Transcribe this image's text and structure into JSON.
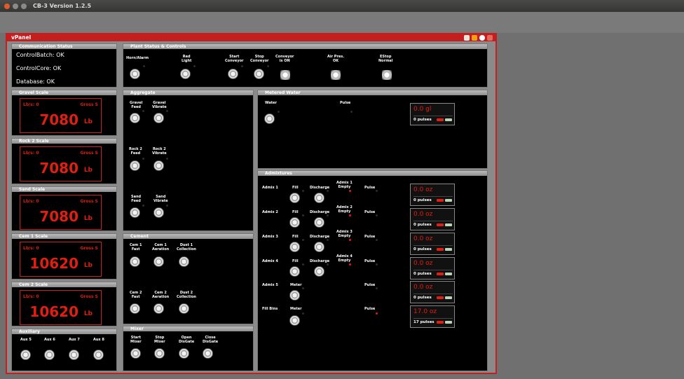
{
  "window": {
    "title": "CB-3 Version 1.2.5"
  },
  "vpanel": {
    "title": "vPanel"
  },
  "communication": {
    "title": "Communication Status",
    "lines": [
      "ControlBatch: OK",
      "ControlCore: OK",
      "Database: OK"
    ]
  },
  "plant": {
    "title": "Plant Status & Controls",
    "horn": "Horn/Alarm",
    "red_light": "Red\nLight",
    "start_conveyor": "Start\nConveyor",
    "stop_conveyor": "Stop\nConveyor",
    "conveyor_on": "Conveyor\nis ON",
    "air_pres": "Air Pres.\nOK",
    "estop": "EStop\nNormal"
  },
  "scales": [
    {
      "title": "Gravel Scale",
      "lbs": "Lb/s: 0",
      "gross": "Gross S",
      "value": "7080",
      "unit": "Lb"
    },
    {
      "title": "Rock 2 Scale",
      "lbs": "Lb/s: 0",
      "gross": "Gross S",
      "value": "7080",
      "unit": "Lb"
    },
    {
      "title": "Sand Scale",
      "lbs": "Lb/s: 0",
      "gross": "Gross S",
      "value": "7080",
      "unit": "Lb"
    },
    {
      "title": "Cem 1 Scale",
      "lbs": "Lb/s: 0",
      "gross": "Gross S",
      "value": "10620",
      "unit": "Lb"
    },
    {
      "title": "Cem 2 Scale",
      "lbs": "Lb/s: 0",
      "gross": "Gross S",
      "value": "10620",
      "unit": "Lb"
    }
  ],
  "auxiliary": {
    "title": "Auxiliary",
    "items": [
      "Aux 5",
      "Aux 6",
      "Aux 7",
      "Aux 8"
    ]
  },
  "aggregate": {
    "title": "Aggregate",
    "gravel_feed": "Gravel\nFeed",
    "gravel_vibrate": "Gravel\nVibrate",
    "rock2_feed": "Rock 2\nFeed",
    "rock2_vibrate": "Rock 2\nVibrate",
    "sand_feed": "Sand\nFeed",
    "sand_vibrate": "Sand\nVibrate"
  },
  "cement": {
    "title": "Cement",
    "cem1_fast": "Cem 1\nFast",
    "cem1_aeration": "Cem 1\nAeration",
    "dust1": "Dust 1\nCollection",
    "cem2_fast": "Cem 2\nFast",
    "cem2_aeration": "Cem 2\nAeration",
    "dust2": "Dust 2\nCollection"
  },
  "mixer": {
    "title": "Mixer",
    "start": "Start\nMixer",
    "stop": "Stop\nMixer",
    "open": "Open\nDisGate",
    "close": "Close\nDisGate"
  },
  "metered_water": {
    "title": "Metered Water",
    "water": "Water",
    "pulse": "Pulse",
    "readout_value": "0.0 gl",
    "readout_pulses": "0 pulses"
  },
  "admixtures": {
    "title": "Admixtures",
    "fill": "Fill",
    "discharge": "Discharge",
    "pulse": "Pulse",
    "meter": "Meter",
    "rows": [
      {
        "name": "Admix 1",
        "empty": "Admix 1\nEmpty",
        "value": "0.0 oz",
        "pulses": "0 pulses"
      },
      {
        "name": "Admix 2",
        "empty": "Admix 2\nEmpty",
        "value": "0.0 oz",
        "pulses": "0 pulses"
      },
      {
        "name": "Admix 3",
        "empty": "Admix 3\nEmpty",
        "value": "0.0 oz",
        "pulses": "0 pulses"
      },
      {
        "name": "Admix 4",
        "empty": "Admix 4\nEmpty",
        "value": "0.0 oz",
        "pulses": "0 pulses"
      },
      {
        "name": "Admix 5",
        "value": "0.0 oz",
        "pulses": "0 pulses"
      },
      {
        "name": "Fill Bins",
        "value": "17.0 oz",
        "pulses": "17 pulses"
      }
    ]
  }
}
